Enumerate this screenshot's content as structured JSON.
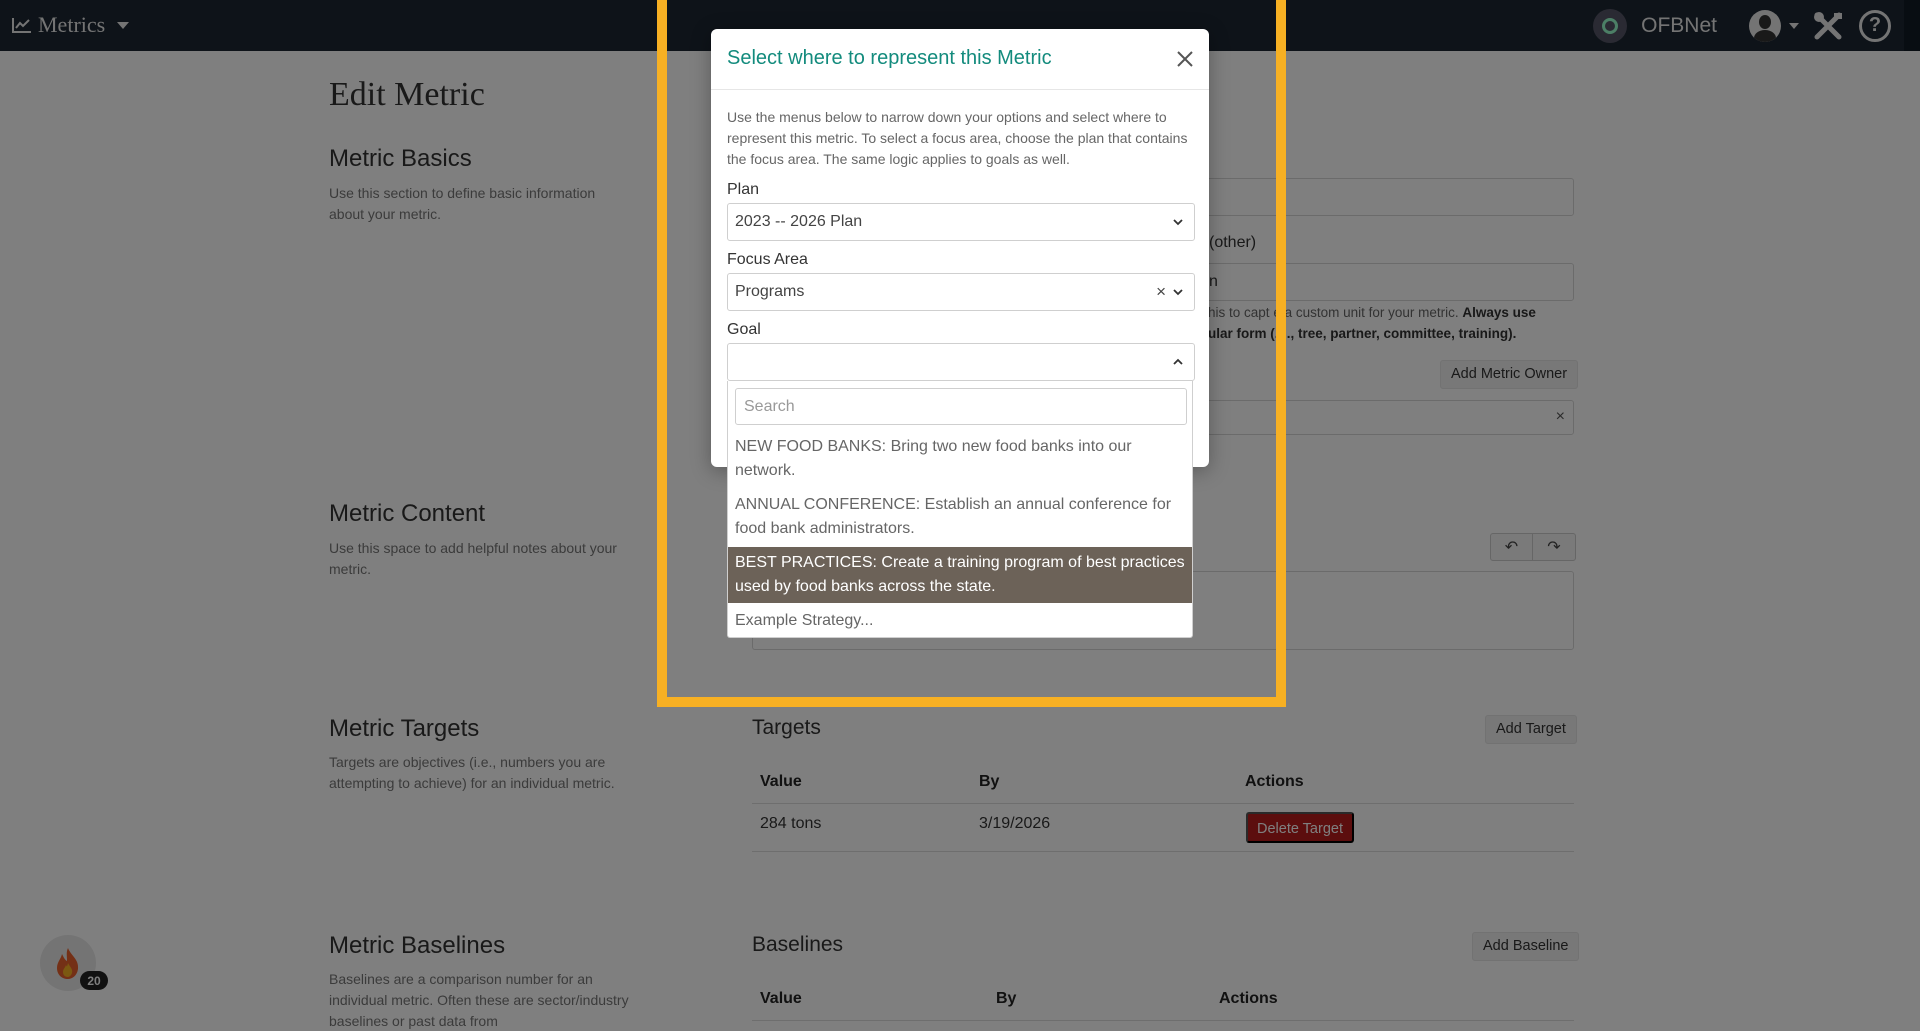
{
  "navbar": {
    "app_name": "Metrics",
    "org_name": "OFBNet"
  },
  "page": {
    "title": "Edit Metric",
    "basics": {
      "title": "Metric Basics",
      "desc": "Use this section to define basic information about your metric.",
      "frag_other": "(other)",
      "frag_n": "n",
      "unit_help_1": "his to capt",
      "unit_help_2": "e a custom unit for your metric.",
      "unit_help_bold": "Always use",
      "unit_help_line2a": "ular form (",
      "unit_help_line2b": ".g., tree, partner, committee, training).",
      "add_owner": "Add Metric Owner",
      "clear": "×"
    },
    "content": {
      "title": "Metric Content",
      "desc": "Use this space to add helpful notes about your metric.",
      "undo": "↶",
      "redo": "↷"
    },
    "targets": {
      "title": "Metric Targets",
      "desc": "Targets are objectives (i.e., numbers you are attempting to achieve) for an individual metric.",
      "table_title": "Targets",
      "add_button": "Add Target",
      "headers": [
        "Value",
        "By",
        "Actions"
      ],
      "rows": [
        {
          "value": "284 tons",
          "by": "3/19/2026",
          "action": "Delete Target"
        }
      ]
    },
    "baselines": {
      "title": "Metric Baselines",
      "desc": "Baselines are a comparison number for an individual metric. Often these are sector/industry baselines or past data from",
      "table_title": "Baselines",
      "add_button": "Add Baseline",
      "headers": [
        "Value",
        "By",
        "Actions"
      ]
    }
  },
  "streak": {
    "count": "20"
  },
  "modal": {
    "title": "Select where to represent this Metric",
    "help": "Use the menus below to narrow down your options and select where to represent this metric. To select a focus area, choose the plan that contains the focus area. The same logic applies to goals as well.",
    "plan_label": "Plan",
    "plan_value": "2023 -- 2026 Plan",
    "focus_label": "Focus Area",
    "focus_value": "Programs",
    "goal_label": "Goal",
    "goal_value": "",
    "clear": "×",
    "search_placeholder": "Search",
    "options": [
      "NEW FOOD BANKS: Bring two new food banks into our network.",
      "ANNUAL CONFERENCE: Establish an annual conference for food bank administrators.",
      "BEST PRACTICES: Create a training program of best practices used by food banks across the state.",
      "Example Strategy..."
    ]
  },
  "colors": {
    "navbar": "#1c2733",
    "modal_title": "#138b7d",
    "highlight": "#f7b023",
    "danger": "#b91c1c",
    "option_active": "#6c6258"
  }
}
